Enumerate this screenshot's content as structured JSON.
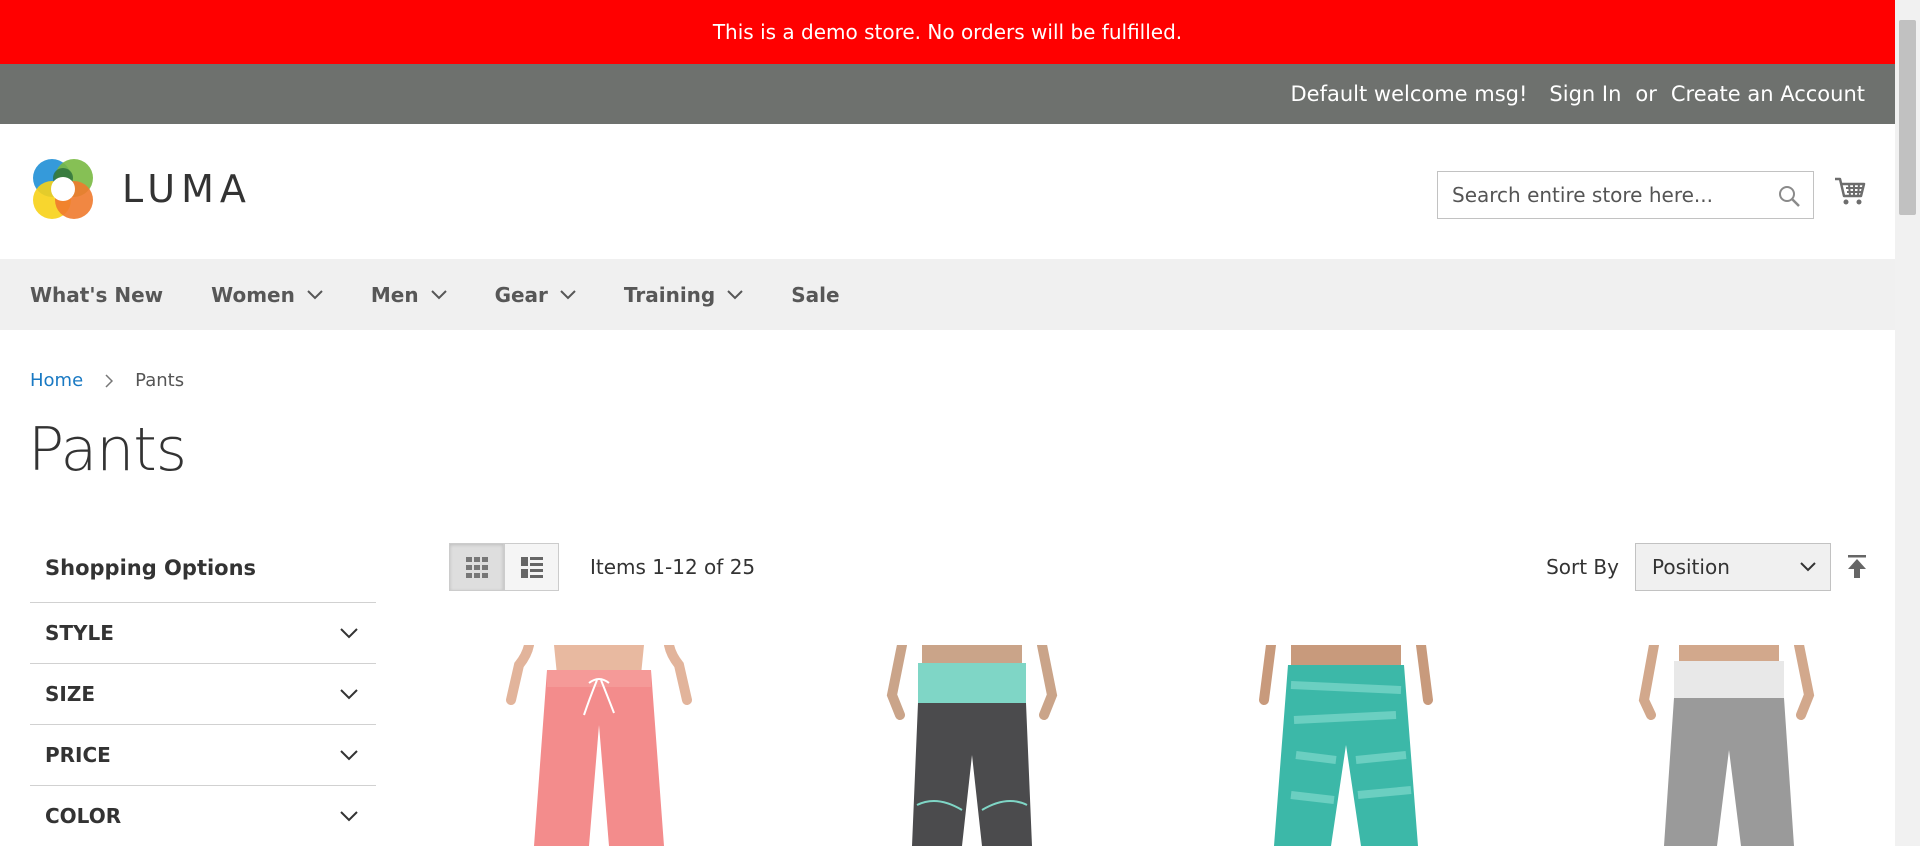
{
  "demo_notice": "This is a demo store. No orders will be fulfilled.",
  "header_links": {
    "welcome": "Default welcome msg!",
    "sign_in": "Sign In",
    "or": "or",
    "create_account": "Create an Account"
  },
  "logo": {
    "text": "LUMA"
  },
  "search": {
    "placeholder": "Search entire store here..."
  },
  "nav": {
    "items": [
      {
        "label": "What's New",
        "has_dropdown": false
      },
      {
        "label": "Women",
        "has_dropdown": true
      },
      {
        "label": "Men",
        "has_dropdown": true
      },
      {
        "label": "Gear",
        "has_dropdown": true
      },
      {
        "label": "Training",
        "has_dropdown": true
      },
      {
        "label": "Sale",
        "has_dropdown": false
      }
    ]
  },
  "breadcrumb": {
    "home": "Home",
    "current": "Pants"
  },
  "page_title": "Pants",
  "sidebar": {
    "title": "Shopping Options",
    "filters": [
      "STYLE",
      "SIZE",
      "PRICE",
      "COLOR"
    ]
  },
  "toolbar": {
    "amount": "Items 1-12 of 25",
    "sort_label": "Sort By",
    "sort_value": "Position"
  },
  "products": [
    {
      "image": "pink-sweatpants"
    },
    {
      "image": "gray-mint-leggings"
    },
    {
      "image": "teal-pattern-leggings"
    },
    {
      "image": "gray-yoga-pants"
    }
  ],
  "colors": {
    "demo_bar": "#ff0000",
    "header_top": "#6e716e",
    "nav_bg": "#f0f0f0",
    "link": "#1979c3"
  }
}
